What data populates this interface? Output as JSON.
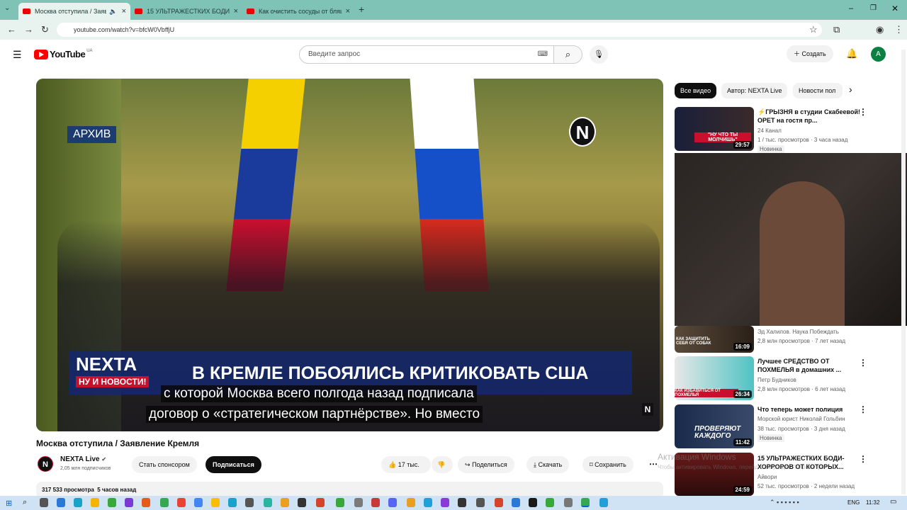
{
  "tabs": [
    {
      "label": "Москва отступила / Заявле",
      "active": true
    },
    {
      "label": "15 УЛЬТРАЖЕСТКИХ БОДИ-",
      "active": false
    },
    {
      "label": "Как очистить сосуды от бляш",
      "active": false
    }
  ],
  "url": "youtube.com/watch?v=bfcW0VbffjU",
  "yt": {
    "logo": "YouTube",
    "region": "UA",
    "search_placeholder": "Введите запрос",
    "create": "Создать",
    "avatar": "A"
  },
  "video": {
    "archive": "АРХИВ",
    "brand": "NEXTA",
    "brand_sub": "НУ И НОВОСТИ!",
    "headline": "В КРЕМЛЕ ПОБОЯЛИСЬ КРИТИКОВАТЬ США",
    "caption1": "с которой Москва всего полгода назад подписала",
    "caption2": "договор о «стратегическом партнёрстве». Но вместо",
    "n_logo": "N"
  },
  "title": "Москва отступила / Заявление Кремля",
  "channel": {
    "name": "NEXTA Live",
    "subs": "2,05 млн подписчиков",
    "sponsor": "Стать спонсором",
    "subscribe": "Подписаться"
  },
  "actions": {
    "likes": "17 тыс.",
    "share": "Поделиться",
    "download": "Скачать",
    "save": "Сохранить"
  },
  "desc": {
    "views": "317 533 просмотра",
    "time": "5 часов назад"
  },
  "chips": [
    "Все видео",
    "Автор: NEXTA Live",
    "Новости пол"
  ],
  "recs": [
    {
      "title": "⚡ГРЫЗНЯ в студии Скабеевой! ОРЕТ на гостя пр...",
      "channel": "24 Канал",
      "meta": "1 / тыс. просмотров · 3 часа назад",
      "badge": "Новинка",
      "duration": "29:57",
      "thumb_text": "\"НУ ЧТО ТЫ МОЛЧИШЬ\""
    },
    {
      "title": "",
      "channel": "Эд Халилов. Наука Побеждать",
      "meta": "2,8 млн просмотров · 7 лет назад",
      "badge": "",
      "duration": "16:09",
      "thumb_text": "КАК ЗАЩИТИТЬ СЕБЯ ОТ СОБАК"
    },
    {
      "title": "Лучшее СРЕДСТВО ОТ ПОХМЕЛЬЯ в домашних ...",
      "channel": "Петр Будников",
      "meta": "2,8 млн просмотров · 6 лет назад",
      "badge": "",
      "duration": "26:34",
      "thumb_text": "КАК ИЗБАВИТЬСЯ ОТ ПОХМЕЛЬЯ"
    },
    {
      "title": "Что теперь может полиция",
      "channel": "Моpской юрист Николай Гольбин",
      "meta": "38 тыс. просмотров · 3 дня назад",
      "badge": "Новинка",
      "duration": "11:42",
      "thumb_text": "ПРОВЕРЯЮТ КАЖДОГО"
    },
    {
      "title": "15 УЛЬТРАЖЕСТКИХ БОДИ-ХОРРОРОВ ОТ КОТОРЫХ...",
      "channel": "Айвори",
      "meta": "52 тыс. просмотров · 2 недели назад",
      "badge": "",
      "duration": "24:59",
      "thumb_text": ""
    }
  ],
  "watermark": {
    "line1": "Активация Windows",
    "line2": "Чтобы активировать Windows, перейдите в раздел \"Параметры\"."
  },
  "tray": {
    "lang": "ENG",
    "time": "11:32"
  }
}
